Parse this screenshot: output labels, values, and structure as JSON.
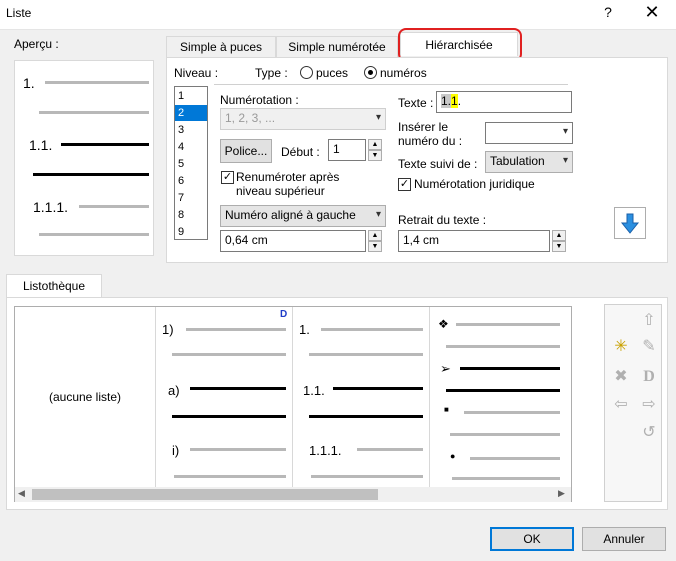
{
  "window": {
    "title": "Liste",
    "help": "?",
    "close": "✕"
  },
  "preview": {
    "label": "Aperçu :",
    "items": [
      "1.",
      "1.1.",
      "1.1.1."
    ]
  },
  "tabs": [
    "Simple à puces",
    "Simple numérotée",
    "Hiérarchisée"
  ],
  "level": {
    "label": "Niveau :",
    "items": [
      "1",
      "2",
      "3",
      "4",
      "5",
      "6",
      "7",
      "8",
      "9"
    ]
  },
  "type": {
    "label": "Type :",
    "opt1": "puces",
    "opt2": "numéros"
  },
  "numbering": {
    "label": "Numérotation :",
    "value": "1, 2, 3, ..."
  },
  "font_button": "Police...",
  "start": {
    "label": "Début :",
    "value": "1"
  },
  "renumber": "Renuméroter après niveau supérieur",
  "alignment": "Numéro aligné à gauche",
  "indent_value": "0,64 cm",
  "text": {
    "label": "Texte :",
    "prefix": "1.",
    "highlight": "1",
    "suffix": "."
  },
  "insert_label": "Insérer le numéro du :",
  "followed": {
    "label": "Texte suivi de :",
    "value": "Tabulation"
  },
  "legal_numbering": "Numérotation juridique",
  "text_indent": {
    "label": "Retrait du texte :",
    "value": "1,4 cm"
  },
  "library": {
    "tab": "Listothèque",
    "none": "(aucune liste)",
    "col1": [
      "1)",
      "a)",
      "i)"
    ],
    "col2": [
      "1.",
      "1.1.",
      "1.1.1."
    ],
    "col3": [
      "❖",
      "➢",
      "■",
      "●"
    ]
  },
  "buttons": {
    "ok": "OK",
    "cancel": "Annuler"
  }
}
